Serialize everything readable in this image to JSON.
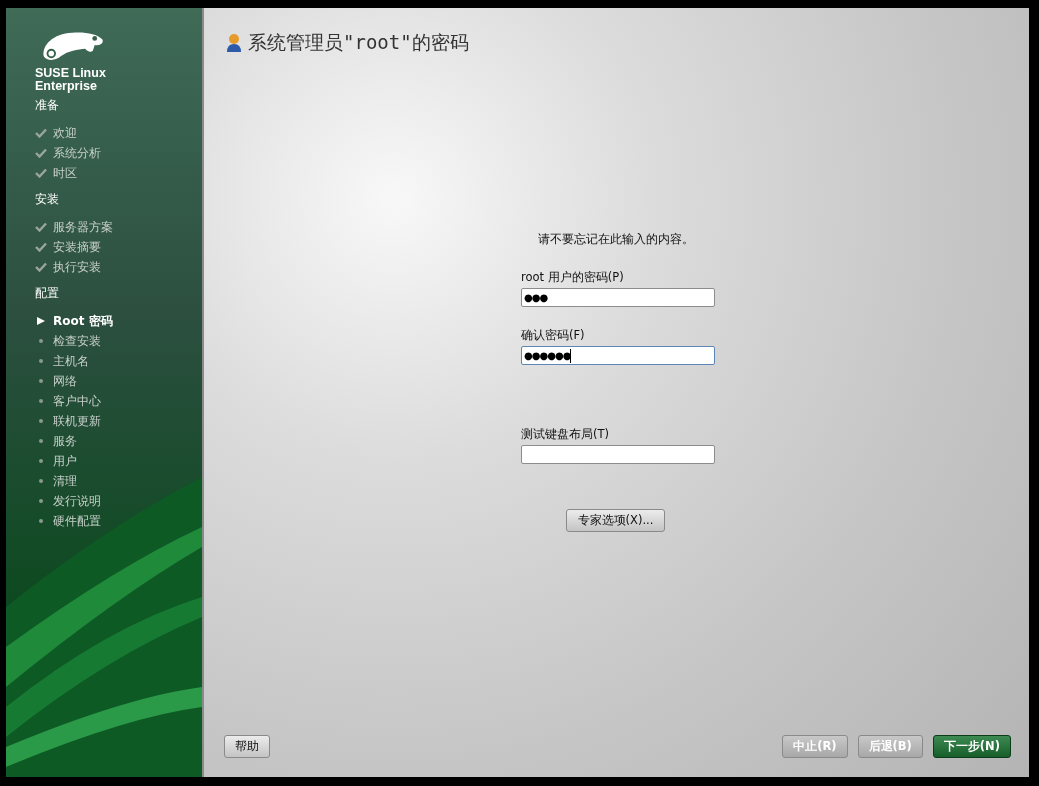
{
  "sidebar": {
    "brand": [
      "SUSE",
      "Linux",
      "Enterprise"
    ],
    "groups": [
      {
        "title": "准备",
        "steps": [
          {
            "label": "欢迎",
            "kind": "done"
          },
          {
            "label": "系统分析",
            "kind": "done"
          },
          {
            "label": "时区",
            "kind": "done"
          }
        ]
      },
      {
        "title": "安装",
        "steps": [
          {
            "label": "服务器方案",
            "kind": "done"
          },
          {
            "label": "安装摘要",
            "kind": "done"
          },
          {
            "label": "执行安装",
            "kind": "done"
          }
        ]
      },
      {
        "title": "配置",
        "steps": [
          {
            "label": "Root 密码",
            "kind": "current"
          },
          {
            "label": "检查安装",
            "kind": "pending"
          },
          {
            "label": "主机名",
            "kind": "pending"
          },
          {
            "label": "网络",
            "kind": "pending"
          },
          {
            "label": "客户中心",
            "kind": "pending"
          },
          {
            "label": "联机更新",
            "kind": "pending"
          },
          {
            "label": "服务",
            "kind": "pending"
          },
          {
            "label": "用户",
            "kind": "pending"
          },
          {
            "label": "清理",
            "kind": "pending"
          },
          {
            "label": "发行说明",
            "kind": "pending"
          },
          {
            "label": "硬件配置",
            "kind": "pending"
          }
        ]
      }
    ]
  },
  "page": {
    "title": "系统管理员\"root\"的密码",
    "note": "请不要忘记在此输入的内容。",
    "fields": [
      {
        "label": "root 用户的密码(P)",
        "value": "●●●",
        "focused": false
      },
      {
        "label": "确认密码(F)",
        "value": "●●●●●●",
        "focused": true
      },
      {
        "label": "测试键盘布局(T)",
        "focused": false
      }
    ],
    "expert_button": "专家选项(X)..."
  },
  "buttons": [
    {
      "label": "帮助",
      "kind": "plain"
    },
    {
      "label": "中止(R)",
      "kind": "plain"
    },
    {
      "label": "后退(B)",
      "kind": "plain"
    },
    {
      "label": "下一步(N)",
      "kind": "primary"
    }
  ]
}
